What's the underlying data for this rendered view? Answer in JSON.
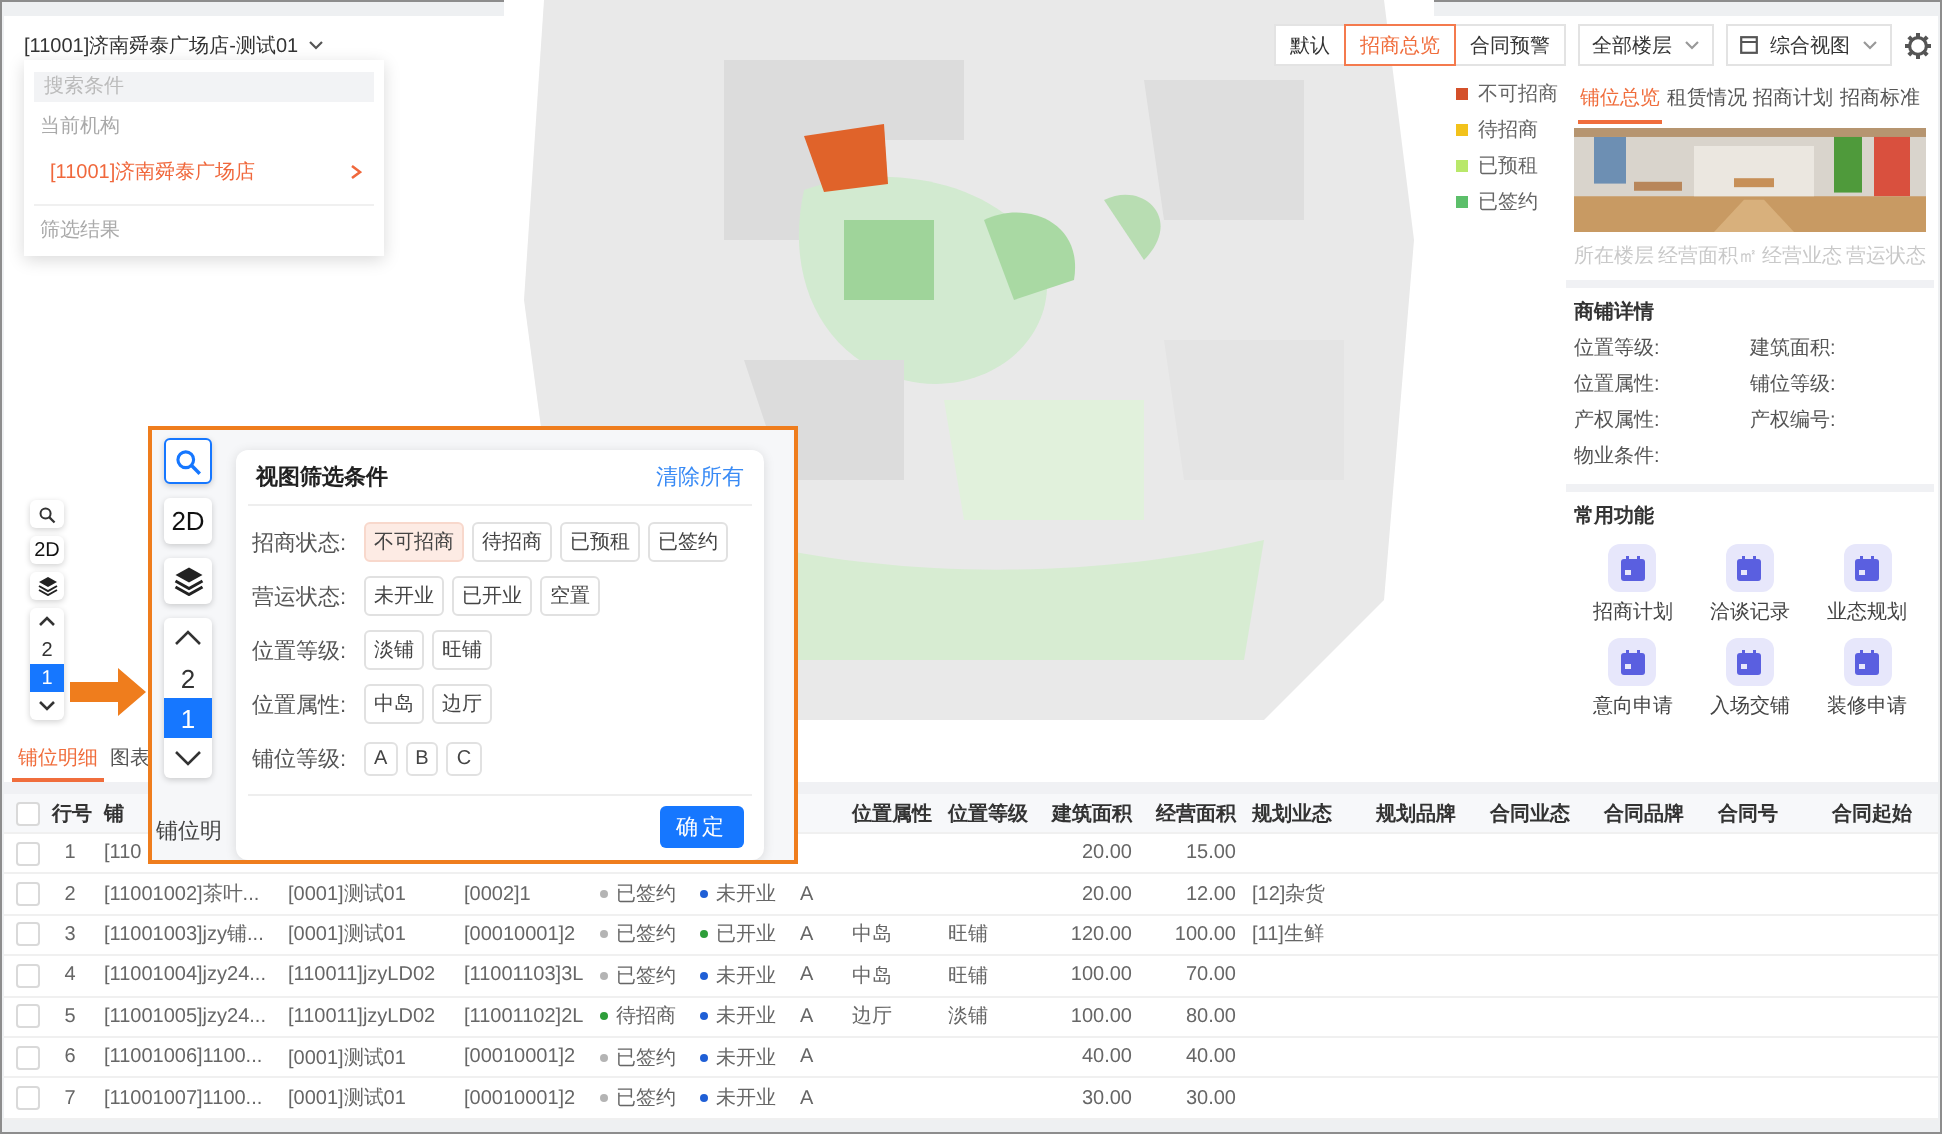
{
  "store_picker": {
    "label": "[11001]济南舜泰广场店-测试01"
  },
  "store_dropdown": {
    "search": {
      "placeholder": "搜索条件"
    },
    "section_label": "当前机构",
    "items": [
      {
        "label": "[11001]济南舜泰广场店",
        "selected": true
      }
    ],
    "footer_label": "筛选结果"
  },
  "view_modes": [
    {
      "label": "默认",
      "selected": false
    },
    {
      "label": "招商总览",
      "selected": true
    },
    {
      "label": "合同预警",
      "selected": false
    }
  ],
  "floor_select": {
    "value": "全部楼层"
  },
  "view_select": {
    "value": "综合视图"
  },
  "legend": [
    {
      "label": "不可招商",
      "color": "#d4502a"
    },
    {
      "label": "待招商",
      "color": "#f2c21b"
    },
    {
      "label": "已预租",
      "color": "#b9e86a"
    },
    {
      "label": "已签约",
      "color": "#5cbf6a"
    }
  ],
  "map_controls": {
    "mode": "2D",
    "floors": [
      {
        "label": "2",
        "selected": false
      },
      {
        "label": "1",
        "selected": true
      }
    ]
  },
  "side_panel": {
    "tabs": [
      {
        "label": "铺位总览",
        "selected": true
      },
      {
        "label": "租赁情况",
        "selected": false
      },
      {
        "label": "招商计划",
        "selected": false
      },
      {
        "label": "招商标准",
        "selected": false
      }
    ],
    "stats": [
      "所在楼层",
      "经营面积㎡",
      "经营业态",
      "营运状态"
    ],
    "details": {
      "title": "商铺详情",
      "fields": [
        "位置等级:",
        "建筑面积:",
        "位置属性:",
        "铺位等级:",
        "产权属性:",
        "产权编号:",
        "物业条件:"
      ]
    },
    "functions": {
      "title": "常用功能",
      "items": [
        "招商计划",
        "洽谈记录",
        "业态规划",
        "意向申请",
        "入场交铺",
        "装修申请"
      ]
    }
  },
  "bottom_tabs": [
    {
      "label": "铺位明细",
      "selected": true
    },
    {
      "label": "图表",
      "selected": false
    }
  ],
  "table": {
    "select_all_checked": false,
    "columns": [
      "行号",
      "铺",
      "位置属性",
      "位置等级",
      "建筑面积",
      "经营面积",
      "规划业态",
      "规划品牌",
      "合同业态",
      "合同品牌",
      "合同号",
      "合同起始"
    ],
    "rows": [
      {
        "checked": false,
        "row_number": "1",
        "shop": "[110",
        "building_area": "20.00",
        "operating_area": "15.00"
      },
      {
        "checked": false,
        "row_number": "2",
        "shop": "[11001002]茶叶...",
        "column_3": "[0001]测试01",
        "column_4": "[0002]1",
        "lease_status": {
          "label": "已签约",
          "color": "#b4b4b4"
        },
        "operation_status": {
          "label": "未开业",
          "color": "#1f5fd6"
        },
        "column_7": "A",
        "building_area": "20.00",
        "operating_area": "12.00",
        "planned_format": "[12]杂货"
      },
      {
        "checked": false,
        "row_number": "3",
        "shop": "[11001003]jzy铺...",
        "column_3": "[0001]测试01",
        "column_4": "[00010001]2",
        "lease_status": {
          "label": "已签约",
          "color": "#b4b4b4"
        },
        "operation_status": {
          "label": "已开业",
          "color": "#2e9e3a"
        },
        "column_7": "A",
        "location_attribute": "中岛",
        "location_grade": "旺铺",
        "building_area": "120.00",
        "operating_area": "100.00",
        "planned_format": "[11]生鲜"
      },
      {
        "checked": false,
        "row_number": "4",
        "shop": "[11001004]jzy24...",
        "column_3": "[110011]jzyLD02",
        "column_4": "[11001103]3L",
        "lease_status": {
          "label": "已签约",
          "color": "#b4b4b4"
        },
        "operation_status": {
          "label": "未开业",
          "color": "#1f5fd6"
        },
        "column_7": "A",
        "location_attribute": "中岛",
        "location_grade": "旺铺",
        "building_area": "100.00",
        "operating_area": "70.00"
      },
      {
        "checked": false,
        "row_number": "5",
        "shop": "[11001005]jzy24...",
        "column_3": "[110011]jzyLD02",
        "column_4": "[11001102]2L",
        "lease_status": {
          "label": "待招商",
          "color": "#2e9e3a"
        },
        "operation_status": {
          "label": "未开业",
          "color": "#1f5fd6"
        },
        "column_7": "A",
        "location_attribute": "边厅",
        "location_grade": "淡铺",
        "building_area": "100.00",
        "operating_area": "80.00"
      },
      {
        "checked": false,
        "row_number": "6",
        "shop": "[11001006]1100...",
        "column_3": "[0001]测试01",
        "column_4": "[00010001]2",
        "lease_status": {
          "label": "已签约",
          "color": "#b4b4b4"
        },
        "operation_status": {
          "label": "未开业",
          "color": "#1f5fd6"
        },
        "column_7": "A",
        "building_area": "40.00",
        "operating_area": "40.00"
      },
      {
        "checked": false,
        "row_number": "7",
        "shop": "[11001007]1100...",
        "column_3": "[0001]测试01",
        "column_4": "[00010001]2",
        "lease_status": {
          "label": "已签约",
          "color": "#b4b4b4"
        },
        "operation_status": {
          "label": "未开业",
          "color": "#1f5fd6"
        },
        "column_7": "A",
        "building_area": "30.00",
        "operating_area": "30.00"
      }
    ]
  },
  "callout": {
    "search_active": true,
    "mode": "2D",
    "floors": [
      {
        "label": "2",
        "selected": false
      },
      {
        "label": "1",
        "selected": true
      }
    ],
    "caption": "铺位明",
    "filter": {
      "title": "视图筛选条件",
      "clear": "清除所有",
      "confirm": "确定",
      "groups": [
        {
          "label": "招商状态:",
          "options": [
            {
              "label": "不可招商",
              "selected": true
            },
            {
              "label": "待招商",
              "selected": false
            },
            {
              "label": "已预租",
              "selected": false
            },
            {
              "label": "已签约",
              "selected": false
            }
          ]
        },
        {
          "label": "营运状态:",
          "options": [
            {
              "label": "未开业",
              "selected": false
            },
            {
              "label": "已开业",
              "selected": false
            },
            {
              "label": "空置",
              "selected": false
            }
          ]
        },
        {
          "label": "位置等级:",
          "options": [
            {
              "label": "淡铺",
              "selected": false
            },
            {
              "label": "旺铺",
              "selected": false
            }
          ]
        },
        {
          "label": "位置属性:",
          "options": [
            {
              "label": "中岛",
              "selected": false
            },
            {
              "label": "边厅",
              "selected": false
            }
          ]
        },
        {
          "label": "铺位等级:",
          "options": [
            {
              "label": "A",
              "selected": false
            },
            {
              "label": "B",
              "selected": false
            },
            {
              "label": "C",
              "selected": false
            }
          ]
        }
      ]
    }
  }
}
